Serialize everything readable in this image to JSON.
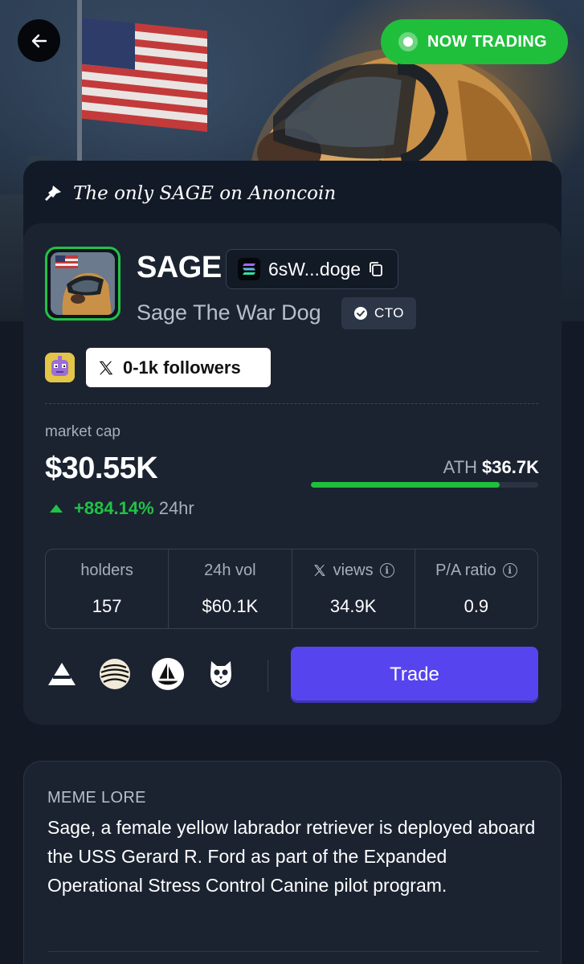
{
  "hero": {
    "status_label": "NOW TRADING",
    "colors": {
      "status": "#1fbf3c"
    }
  },
  "token": {
    "tagline": "The only SAGE on Anoncoin",
    "symbol": "SAGE",
    "address_short": "6sW...doge",
    "name": "Sage The War Dog",
    "cto_label": "CTO",
    "followers_label": "0-1k followers"
  },
  "market": {
    "label": "market cap",
    "value": "$30.55K",
    "ath_label": "ATH",
    "ath_value": "$36.7K",
    "ath_progress": 0.832,
    "change": "+884.14%",
    "change_period": "24hr"
  },
  "stats": [
    {
      "label": "holders",
      "value": "157"
    },
    {
      "label": "24h vol",
      "value": "$60.1K"
    },
    {
      "label": "views",
      "value": "34.9K",
      "icon": "x-logo-icon",
      "info": true
    },
    {
      "label": "P/A ratio",
      "value": "0.9",
      "info": true
    }
  ],
  "links": [
    "triangle-icon",
    "stripes-globe-icon",
    "sailboat-icon",
    "owl-icon"
  ],
  "actions": {
    "trade_label": "Trade"
  },
  "lore": {
    "title": "MEME LORE",
    "text": "Sage, a female yellow labrador retriever is deployed aboard the USS Gerard R. Ford as part of the Expanded Operational Stress Control Canine pilot program."
  },
  "colors": {
    "accent": "#5644ee",
    "positive": "#22c246",
    "background": "#131a26"
  }
}
